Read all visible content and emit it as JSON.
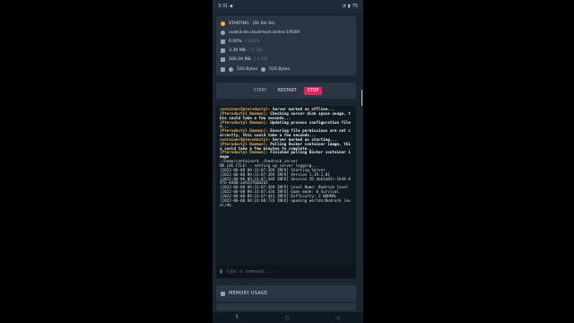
{
  "statusbar": {
    "time": "3:31",
    "battery": "75"
  },
  "server": {
    "status": "STARTING",
    "uptime": "(0h 0m 0s)",
    "address": "node3-de.cloud-host.online:19549",
    "cpu": "0.00%",
    "cpu_limit": "/ 200%",
    "memory": "3.39 MB",
    "memory_limit": "/ 5 GB",
    "disk": "266.04 MB",
    "disk_limit": "/ 5 GB",
    "net_in": "520 Bytes",
    "net_out": "520 Bytes"
  },
  "controls": {
    "start": "START",
    "restart": "RESTART",
    "stop": "STOP"
  },
  "console": {
    "lines": [
      {
        "prompt": "container@pterodactyl~",
        "text": " Server marked as offline..."
      },
      {
        "prefix": "[Pterodactyl Daemon]:",
        "text": " Checking server disk space usage, this could take a few seconds..."
      },
      {
        "prefix": "[Pterodactyl Daemon]:",
        "text": " Updating process configuration files..."
      },
      {
        "prefix": "[Pterodactyl Daemon]:",
        "text": " Ensuring file permissions are set correctly, this could take a few seconds..."
      },
      {
        "prompt": "container@pterodactyl~",
        "text": " Server marked as starting..."
      },
      {
        "prefix": "[Pterodactyl Daemon]:",
        "text": " Pulling Docker container image, this could take a few minutes to complete..."
      },
      {
        "prefix": "[Pterodactyl Daemon]:",
        "text": " Finished pulling Docker container image"
      },
      {
        "text": ":/home/container$ ./bedrock_server"
      },
      {
        "text": "NO LOG FILE! - setting up server logging..."
      },
      {
        "text": "[2022-06-08 09:31:07:369 INFO] Starting Server"
      },
      {
        "text": "[2022-06-08 09:31:07:369 INFO] Version 1.19.1.01"
      },
      {
        "text": "[2022-06-08 09:31:07:369 INFO] Session ID dab1a82c-1b44-497b-8480-ae92d7b0d2b5"
      },
      {
        "text": "[2022-06-08 09:31:07:369 INFO] Level Name: Bedrock level"
      },
      {
        "text": "[2022-06-08 09:31:07:434 INFO] Game mode: 0 Survival"
      },
      {
        "text": "[2022-06-08 09:31:07:441 INFO] Difficulty: 2 NORMAL"
      },
      {
        "text": "[2022-06-08 09:31:08:733 INFO] opening worlds/Bedrock level/db"
      }
    ]
  },
  "command": {
    "placeholder": "Type a command..."
  },
  "memory_panel": {
    "title": "MEMORY USAGE"
  },
  "colors": {
    "stop": "#e0245e",
    "status_dot": "#f2b63a",
    "accent_text": "#e6b84c"
  }
}
